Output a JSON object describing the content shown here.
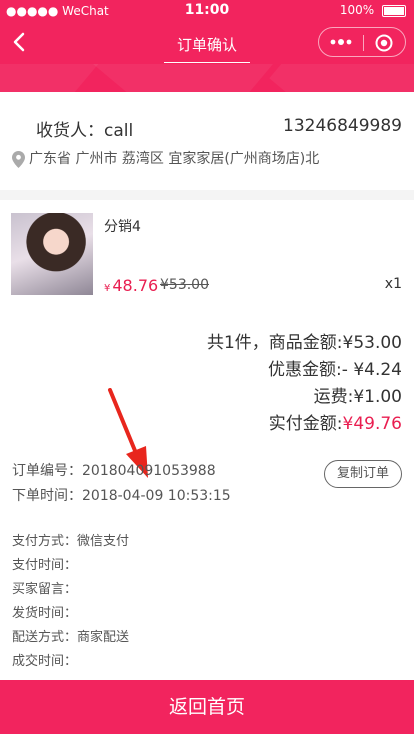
{
  "status_bar": {
    "carrier": "●●●●● WeChat",
    "time": "11:00",
    "battery": "100%"
  },
  "navbar": {
    "title": "订单确认"
  },
  "address": {
    "recipient_label": "收货人：",
    "recipient_name": "call",
    "phone": "13246849989",
    "address_text": "广东省 广州市 荔湾区 宜家家居(广州商场店)北"
  },
  "product": {
    "name": "分销4",
    "currency": "¥",
    "price": "48.76",
    "original_price": "¥53.00",
    "quantity": "x1"
  },
  "summary": {
    "goods_total_label": "共1件，商品金额:",
    "goods_total_value": "¥53.00",
    "discount_label": "优惠金额:",
    "discount_value": "- ¥4.24",
    "shipping_label": "运费:",
    "shipping_value": "¥1.00",
    "paid_label": "实付金额:",
    "paid_value": "¥49.76"
  },
  "order_meta": {
    "order_no_label": "订单编号：",
    "order_no": "201804091053988",
    "order_time_label": "下单时间：",
    "order_time": "2018-04-09 10:53:15",
    "copy_button": "复制订单"
  },
  "details": {
    "payment_method": "支付方式：微信支付",
    "payment_time": "支付时间：",
    "buyer_message": "买家留言：",
    "ship_time": "发货时间：",
    "delivery_method": "配送方式：商家配送",
    "deal_time": "成交时间："
  },
  "bottom": {
    "home_button": "返回首页"
  },
  "colors": {
    "brand": "#f2245e",
    "price_red": "#e91e50"
  }
}
